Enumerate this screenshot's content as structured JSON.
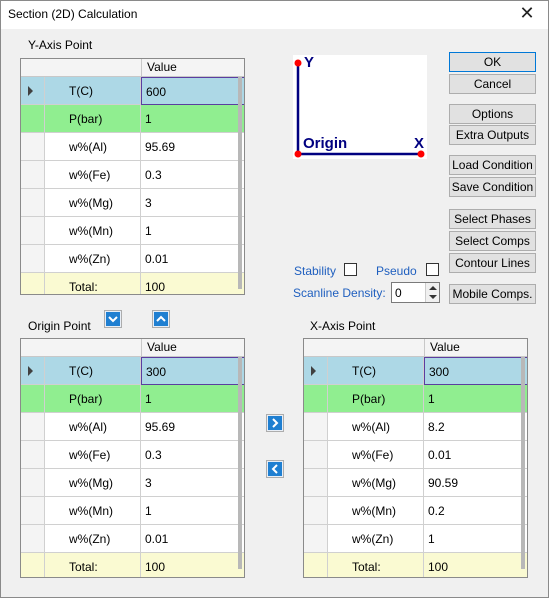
{
  "window": {
    "title": "Section (2D) Calculation",
    "close_glyph": "✕"
  },
  "groups": {
    "y_axis": "Y-Axis Point",
    "origin": "Origin Point",
    "x_axis": "X-Axis Point"
  },
  "grid_header": {
    "value": "Value"
  },
  "y_grid": {
    "rows": [
      {
        "name": "T(C)",
        "value": "600"
      },
      {
        "name": "P(bar)",
        "value": "1"
      },
      {
        "name": "w%(Al)",
        "value": "95.69"
      },
      {
        "name": "w%(Fe)",
        "value": "0.3"
      },
      {
        "name": "w%(Mg)",
        "value": "3"
      },
      {
        "name": "w%(Mn)",
        "value": "1"
      },
      {
        "name": "w%(Zn)",
        "value": "0.01"
      },
      {
        "name": "Total:",
        "value": "100"
      }
    ]
  },
  "origin_grid": {
    "rows": [
      {
        "name": "T(C)",
        "value": "300"
      },
      {
        "name": "P(bar)",
        "value": "1"
      },
      {
        "name": "w%(Al)",
        "value": "95.69"
      },
      {
        "name": "w%(Fe)",
        "value": "0.3"
      },
      {
        "name": "w%(Mg)",
        "value": "3"
      },
      {
        "name": "w%(Mn)",
        "value": "1"
      },
      {
        "name": "w%(Zn)",
        "value": "0.01"
      },
      {
        "name": "Total:",
        "value": "100"
      }
    ]
  },
  "x_grid": {
    "rows": [
      {
        "name": "T(C)",
        "value": "300"
      },
      {
        "name": "P(bar)",
        "value": "1"
      },
      {
        "name": "w%(Al)",
        "value": "8.2"
      },
      {
        "name": "w%(Fe)",
        "value": "0.01"
      },
      {
        "name": "w%(Mg)",
        "value": "90.59"
      },
      {
        "name": "w%(Mn)",
        "value": "0.2"
      },
      {
        "name": "w%(Zn)",
        "value": "1"
      },
      {
        "name": "Total:",
        "value": "100"
      }
    ]
  },
  "axis_diagram": {
    "y_label": "Y",
    "x_label": "X",
    "origin_label": "Origin"
  },
  "buttons": {
    "ok": "OK",
    "cancel": "Cancel",
    "options": "Options",
    "extra_outputs": "Extra Outputs",
    "load_condition": "Load Condition",
    "save_condition": "Save Condition",
    "select_phases": "Select Phases",
    "select_comps": "Select Comps",
    "contour_lines": "Contour Lines",
    "mobile_comps": "Mobile Comps."
  },
  "options": {
    "stability": "Stability",
    "stability_checked": false,
    "pseudo": "Pseudo",
    "pseudo_checked": false,
    "scanline_density": "Scanline Density:",
    "scanline_value": "0"
  },
  "colors": {
    "accent_blue": "#1f5fbf",
    "temp_row": "#add8e6",
    "pressure_row": "#90ee90",
    "total_row": "#fafad2",
    "axis_line": "#000080",
    "axis_point": "#ff0000",
    "axis_text": "#000080"
  },
  "icons": {
    "copy_down": "chevron-down-icon",
    "copy_up": "chevron-up-icon",
    "copy_right": "chevron-right-icon",
    "copy_left": "chevron-left-icon"
  }
}
